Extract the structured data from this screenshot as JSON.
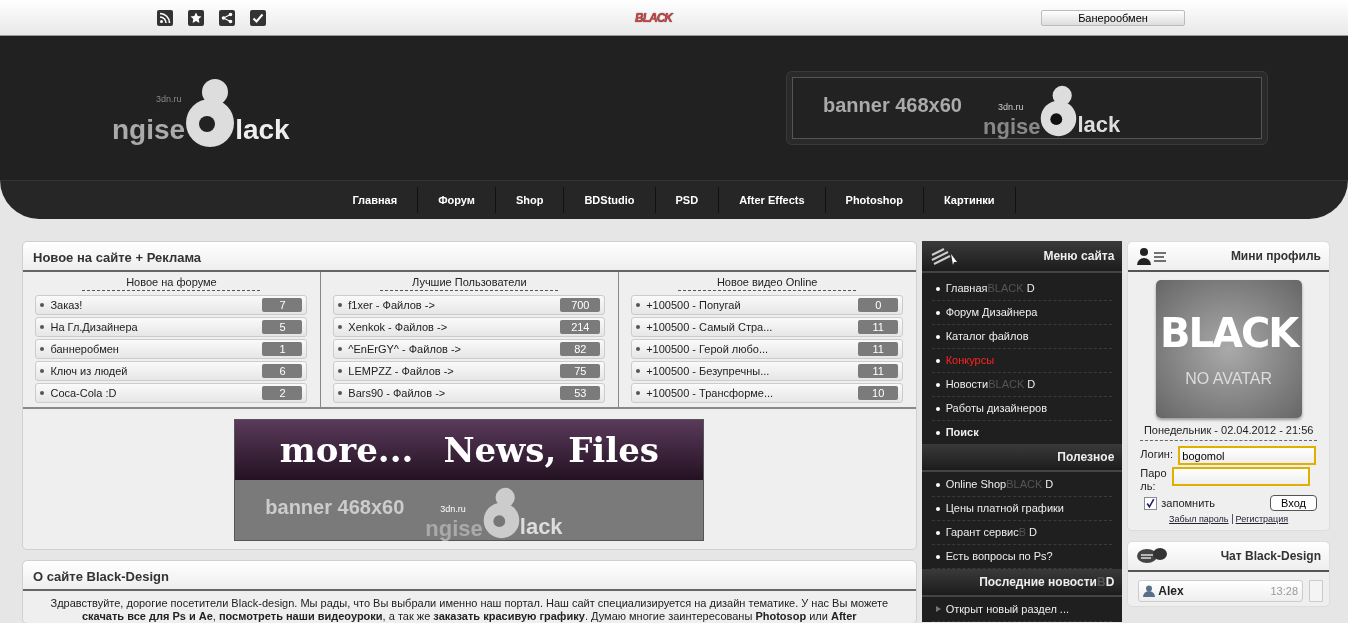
{
  "topbar": {
    "logo": "BLACK",
    "exchange_button": "Банерообмен"
  },
  "header": {
    "logo": {
      "left": "ngise",
      "right": "lack",
      "domain": "3dn.ru"
    },
    "banner": {
      "text": "banner 468x60",
      "left": "ngise",
      "right": "lack",
      "domain": "3dn.ru"
    }
  },
  "nav": [
    "Главная",
    "Форум",
    "Shop",
    "BDStudio",
    "PSD",
    "After Effects",
    "Photoshop",
    "Картинки"
  ],
  "news_panel": {
    "title": "Новое на сайте + Реклама",
    "columns": [
      {
        "title": "Новое на форуме",
        "items": [
          {
            "label": "Заказ!",
            "count": "7"
          },
          {
            "label": "На Гл.Дизайнера",
            "count": "5"
          },
          {
            "label": "баннеробмен",
            "count": "1"
          },
          {
            "label": "Ключ из людей",
            "count": "6"
          },
          {
            "label": "Coca-Cola :D",
            "count": "2"
          }
        ]
      },
      {
        "title": "Лучшие Пользователи",
        "items": [
          {
            "label": "f1xer - Файлов ->",
            "count": "700"
          },
          {
            "label": "Xenkok - Файлов ->",
            "count": "214"
          },
          {
            "label": "^EnErGY^ - Файлов ->",
            "count": "82"
          },
          {
            "label": "LEMPZZ - Файлов ->",
            "count": "75"
          },
          {
            "label": "Bars90 - Файлов ->",
            "count": "53"
          }
        ]
      },
      {
        "title": "Новое видео Online",
        "items": [
          {
            "label": "+100500 - Попугай",
            "count": "0"
          },
          {
            "label": "+100500 - Самый Стра...",
            "count": "11"
          },
          {
            "label": "+100500 - Герой любо...",
            "count": "11"
          },
          {
            "label": "+100500 - Безупречны...",
            "count": "11"
          },
          {
            "label": "+100500 - Трансформе...",
            "count": "10"
          }
        ]
      }
    ],
    "banner": {
      "top_left": "more...",
      "top_right": "News, Files",
      "text": "banner 468x60",
      "left": "ngise",
      "right": "lack",
      "domain": "3dn.ru"
    }
  },
  "about": {
    "title": "О сайте Black-Design",
    "lines": [
      "Здравствуйте, дорогие посетители Black-design. Мы рады, что Вы выбрали именно наш портал. Наш сайт специализируется на дизайн тематике. У нас Вы можете",
      "**скачать все для Ps и Ae**, **посмотреть наши видеоуроки**, а так же **заказать красивую графику**. Думаю многие заинтересованы **Photosop** или **After**"
    ]
  },
  "site_menu": {
    "sections": [
      {
        "title": {
          "label": "Меню сайта"
        },
        "items": [
          {
            "kind": "link",
            "label": "Главная",
            "dim": "BLACK",
            "tail": "D"
          },
          {
            "kind": "link",
            "label": "Форум Дизайнера"
          },
          {
            "kind": "link",
            "label": "Каталог файлов"
          },
          {
            "kind": "alert",
            "label": "Конкурсы"
          },
          {
            "kind": "link",
            "label": "Новости",
            "dim": "BLACK",
            "tail": "D"
          },
          {
            "kind": "link",
            "label": "Работы дизайнеров"
          },
          {
            "kind": "strong",
            "label": "Поиск"
          }
        ]
      },
      {
        "title": {
          "label": "Полезное"
        },
        "items": [
          {
            "kind": "link",
            "label": "Online Shop",
            "dim": "BLACK",
            "tail": "D"
          },
          {
            "kind": "link",
            "label": "Цены платной графики"
          },
          {
            "kind": "link",
            "label": "Гарант сервис",
            "dim": "B",
            "tail": "D"
          },
          {
            "kind": "link",
            "label": "Есть вопросы по Ps?"
          }
        ]
      },
      {
        "title": {
          "label": "Последние новости",
          "dim": "B",
          "tail": "D"
        },
        "items": [
          {
            "kind": "news",
            "label": "Открыт новый раздел ..."
          }
        ]
      }
    ]
  },
  "profile": {
    "title": "Мини профиль",
    "avatar": {
      "brand": "BLACK",
      "caption": "NO AVATAR"
    },
    "date": "Понедельник - 02.04.2012 - 21:56",
    "login_label": "Логин:",
    "login_value": "bogomol",
    "password_label": "Пароль:",
    "remember": {
      "label": "запомнить",
      "checked": true
    },
    "submit": "Вход",
    "links": [
      "Забыл пароль",
      "Регистрация"
    ]
  },
  "chat": {
    "title": "Чат Black-Design",
    "messages": [
      {
        "user": "Alex",
        "time": "13:28"
      }
    ]
  }
}
